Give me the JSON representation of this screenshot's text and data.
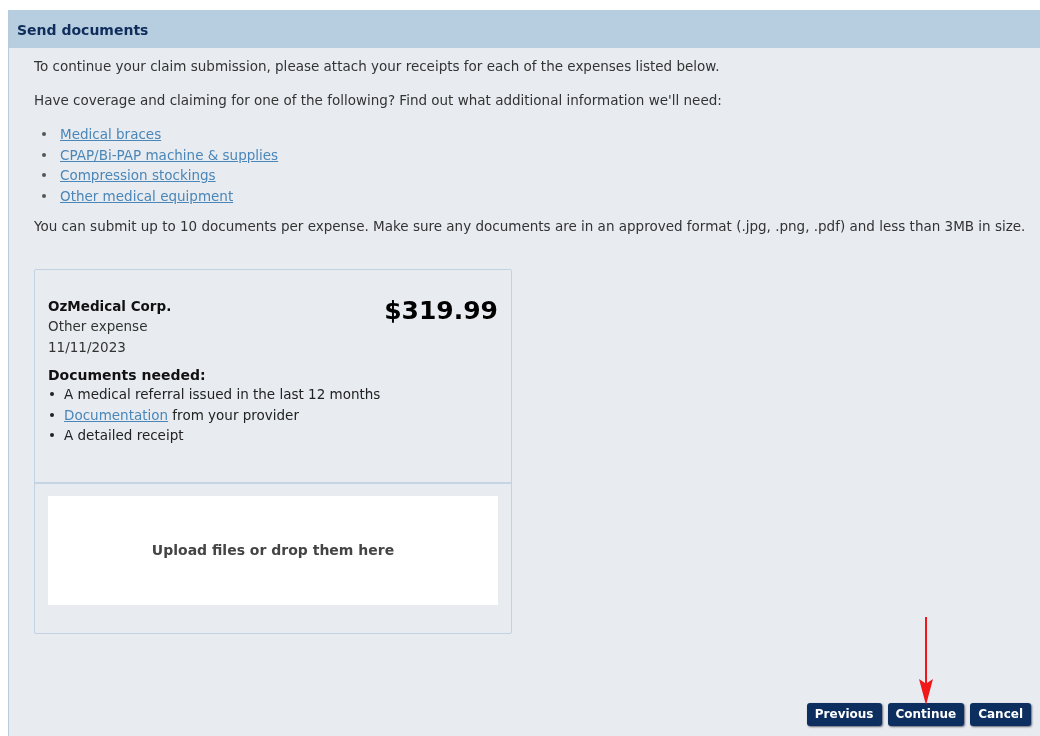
{
  "panel": {
    "title": "Send documents"
  },
  "intro": "To continue your claim submission, please attach your receipts for each of the expenses listed below.",
  "coverage_prompt": "Have coverage and claiming for one of the following? Find out what additional information we'll need:",
  "coverage_links": [
    "Medical braces",
    "CPAP/Bi-PAP machine & supplies",
    "Compression stockings",
    "Other medical equipment"
  ],
  "limits_note": "You can submit up to 10 documents per expense. Make sure any documents are in an approved format (.jpg, .png, .pdf) and less than 3MB in size.",
  "expense": {
    "provider": "OzMedical Corp.",
    "type": "Other expense",
    "date": "11/11/2023",
    "amount": "$319.99",
    "documents_heading": "Documents needed:",
    "documents": [
      {
        "kind": "text",
        "text": "A medical referral issued in the last 12 months"
      },
      {
        "kind": "link",
        "link": "Documentation",
        "text": " from your provider"
      },
      {
        "kind": "text",
        "text": "A detailed receipt"
      }
    ],
    "upload_label": "Upload files or drop them here"
  },
  "buttons": [
    "Previous",
    "Continue",
    "Cancel"
  ]
}
